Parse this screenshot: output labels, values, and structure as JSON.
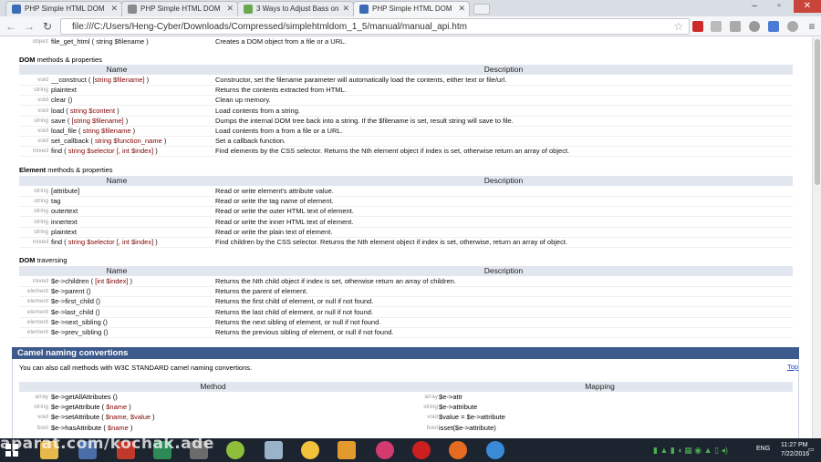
{
  "browser": {
    "tabs": [
      {
        "title": "PHP Simple HTML DOM",
        "active": false,
        "fav_color": "#3b6bb4"
      },
      {
        "title": "PHP Simple HTML DOM",
        "active": false,
        "fav_color": "#8a8a8a"
      },
      {
        "title": "3 Ways to Adjust Bass on",
        "active": false,
        "fav_color": "#6aa84f"
      },
      {
        "title": "PHP Simple HTML DOM",
        "active": true,
        "fav_color": "#3b6bb4"
      }
    ],
    "url": "file:///C:/Users/Heng-Cyber/Downloads/Compressed/simplehtmldom_1_5/manual/manual_api.htm"
  },
  "top_row": {
    "ret": "object",
    "sig": "file_get_html ( string $filename )",
    "desc": "Creates a DOM object from a file or a URL."
  },
  "sections": [
    {
      "title_bold": "DOM",
      "title_rest": " methods & properties",
      "col1": "Name",
      "col2": "Description",
      "rows": [
        {
          "ret": "void",
          "sig": "__construct ( [string $filename] )",
          "desc": "Constructor, set the filename parameter will automatically load the contents, either text or file/url."
        },
        {
          "ret": "string",
          "sig": "plaintext",
          "desc": "Returns the contents extracted from HTML."
        },
        {
          "ret": "void",
          "sig": "clear ()",
          "desc": "Clean up memory."
        },
        {
          "ret": "void",
          "sig": "load ( string $content )",
          "desc": "Load contents from a string."
        },
        {
          "ret": "string",
          "sig": "save ( [string $filename] )",
          "desc": "Dumps the internal DOM tree back into a string. If the $filename is set, result string will save to file."
        },
        {
          "ret": "void",
          "sig": "load_file ( string $filename )",
          "desc": "Load contents from a from a file or a URL."
        },
        {
          "ret": "void",
          "sig": "set_callback ( string $function_name )",
          "desc": "Set a callback function."
        },
        {
          "ret": "mixed",
          "sig": "find ( string $selector [, int $index] )",
          "desc": "Find elements by the CSS selector. Returns the Nth element object if index is set, otherwise return an array of object."
        }
      ]
    },
    {
      "title_bold": "Element",
      "title_rest": " methods & properties",
      "col1": "Name",
      "col2": "Description",
      "rows": [
        {
          "ret": "string",
          "sig": "[attribute]",
          "desc": "Read or write element's attribute value."
        },
        {
          "ret": "string",
          "sig": "tag",
          "desc": "Read or write the tag name of element."
        },
        {
          "ret": "string",
          "sig": "outertext",
          "desc": "Read or write the outer HTML text of element."
        },
        {
          "ret": "string",
          "sig": "innertext",
          "desc": "Read or write the inner HTML text of element."
        },
        {
          "ret": "string",
          "sig": "plaintext",
          "desc": "Read or write the plain text of element."
        },
        {
          "ret": "mixed",
          "sig": "find ( string $selector [, int $index] )",
          "desc": "Find children by the CSS selector. Returns the Nth element object if index is set, otherwise, return an array of object."
        }
      ]
    },
    {
      "title_bold": "DOM",
      "title_rest": " traversing",
      "col1": "Name",
      "col2": "Description",
      "rows": [
        {
          "ret": "mixed",
          "sig": "$e->children ( [int $index] )",
          "desc": "Returns the Nth child object if index is set, otherwise return an array of children."
        },
        {
          "ret": "element",
          "sig": "$e->parent ()",
          "desc": "Returns the parent of element."
        },
        {
          "ret": "element",
          "sig": "$e->first_child ()",
          "desc": "Returns the first child of element, or null if not found."
        },
        {
          "ret": "element",
          "sig": "$e->last_child ()",
          "desc": "Returns the last child of element, or null if not found."
        },
        {
          "ret": "element",
          "sig": "$e->next_sibling ()",
          "desc": "Returns the next sibling of element, or null if not found."
        },
        {
          "ret": "element",
          "sig": "$e->prev_sibling ()",
          "desc": "Returns the previous sibling of element, or null if not found."
        }
      ]
    }
  ],
  "camel": {
    "title": "Camel naming convertions",
    "intro": "You can also call methods with W3C STANDARD camel naming convertions.",
    "top_link": "Top",
    "col1": "Method",
    "col2": "Mapping",
    "rows": [
      {
        "ret": "array",
        "sig": "$e->getAllAttributes ()",
        "mret": "array",
        "map": "$e->attr"
      },
      {
        "ret": "string",
        "sig": "$e->getAttribute ( $name )",
        "mret": "string",
        "map": "$e->attribute"
      },
      {
        "ret": "void",
        "sig": "$e->setAttribute ( $name, $value )",
        "mret": "void",
        "map": "$value = $e->attribute"
      },
      {
        "ret": "bool",
        "sig": "$e->hasAttribute ( $name )",
        "mret": "bool",
        "map": "isset($e->attribute)"
      }
    ]
  },
  "taskbar": {
    "lang": "ENG",
    "time": "11:27 PM",
    "date": "7/22/2016",
    "watermark": "aparat.com/kochak.ade"
  },
  "colors": {
    "header_bg": "#e2e7ef",
    "camel_bar": "#3d5a8c",
    "taskbar": "#1c2430",
    "param": "#800000"
  }
}
